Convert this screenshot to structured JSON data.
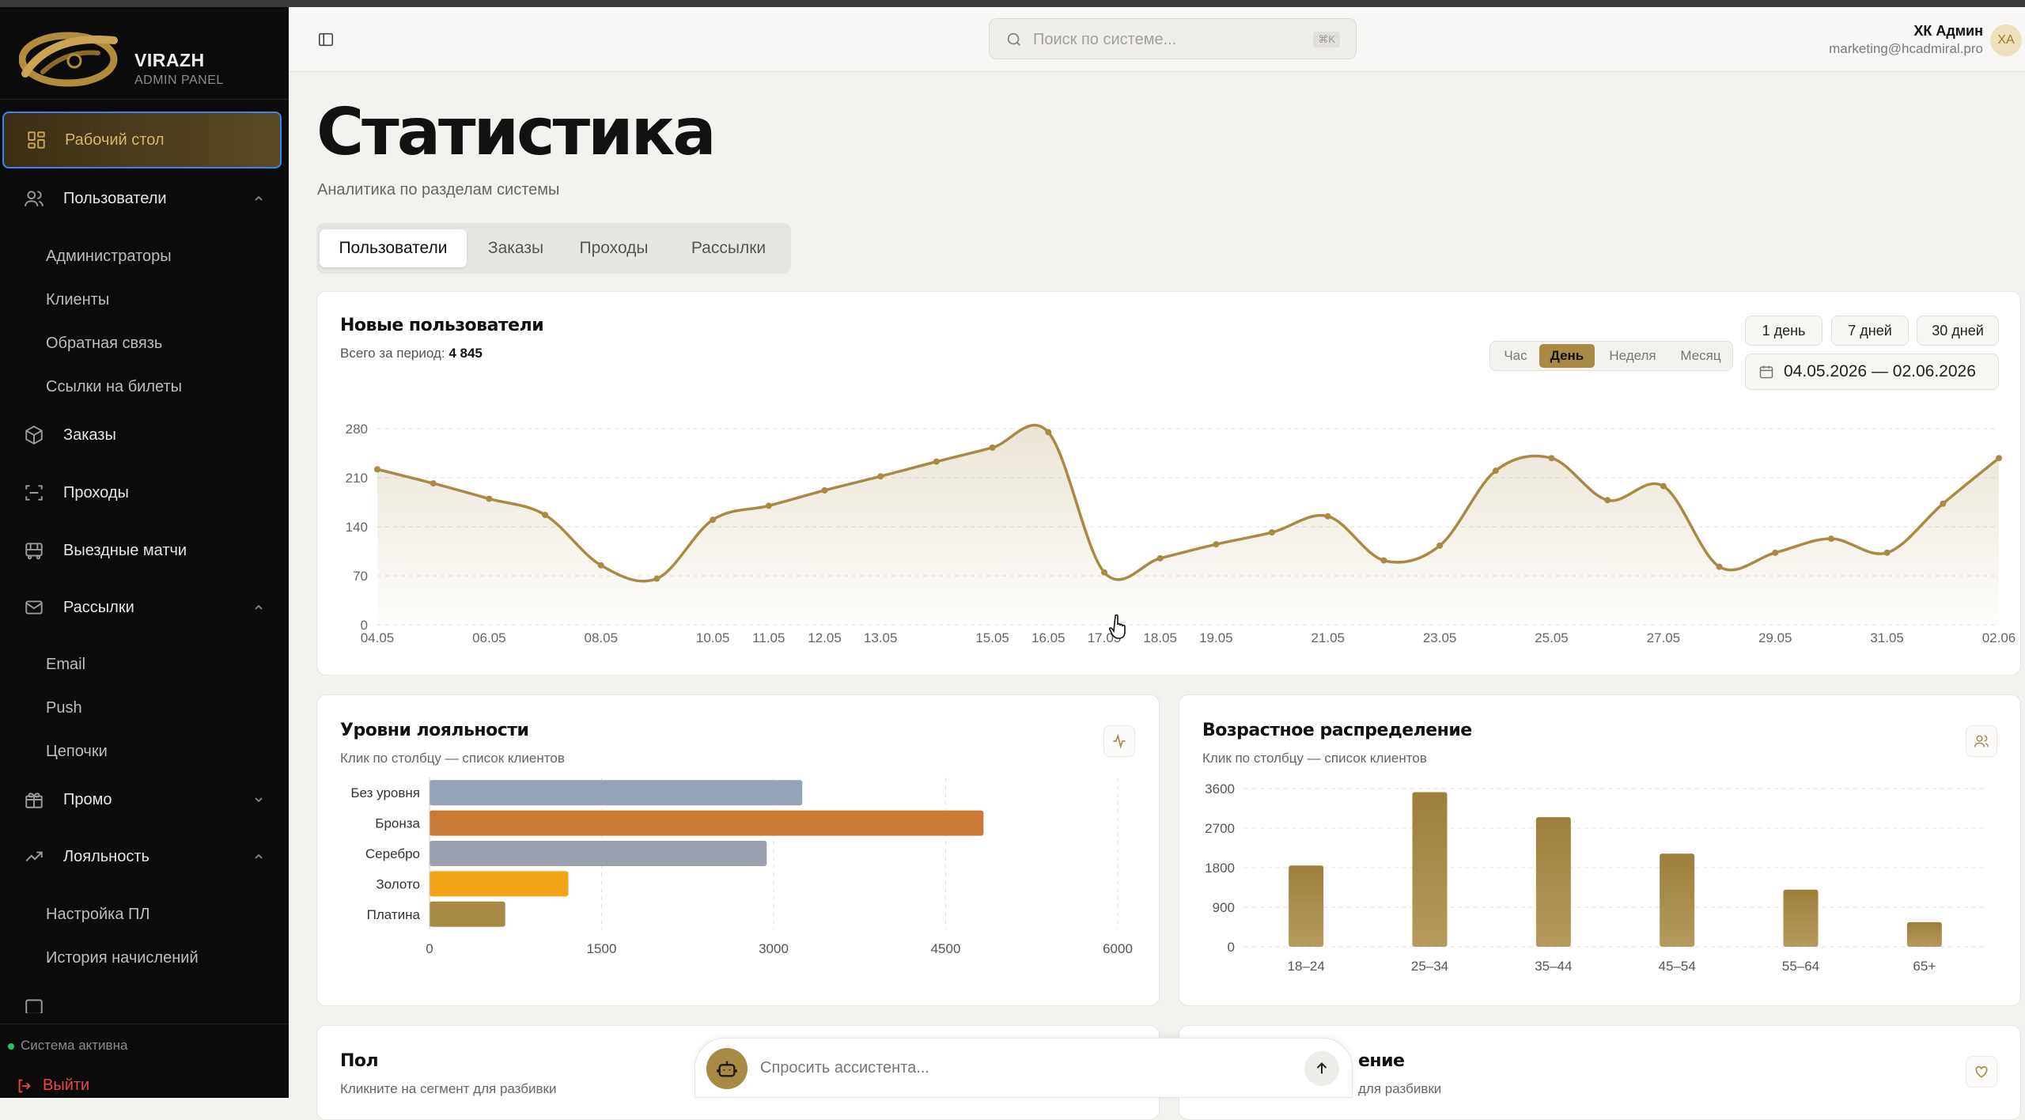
{
  "brand": {
    "name": "VIRAZH",
    "subtitle": "ADMIN PANEL"
  },
  "sidebar": {
    "active": "Рабочий стол",
    "items": [
      {
        "label": "Пользователи",
        "icon": "users-icon",
        "sub": [
          "Администраторы",
          "Клиенты",
          "Обратная связь",
          "Ссылки на билеты"
        ]
      },
      {
        "label": "Заказы",
        "icon": "box-icon"
      },
      {
        "label": "Проходы",
        "icon": "scan-icon"
      },
      {
        "label": "Выездные матчи",
        "icon": "bus-icon"
      },
      {
        "label": "Рассылки",
        "icon": "mail-icon",
        "sub": [
          "Email",
          "Push",
          "Цепочки"
        ]
      },
      {
        "label": "Промо",
        "icon": "gift-icon"
      },
      {
        "label": "Лояльность",
        "icon": "trend-up-icon",
        "sub": [
          "Настройка ПЛ",
          "История начислений"
        ]
      }
    ],
    "status": "Система активна",
    "logout": "Выйти"
  },
  "header": {
    "search_placeholder": "Поиск по системе...",
    "search_shortcut": "⌘K",
    "user_name": "ХК Админ",
    "user_email": "marketing@hcadmiral.pro",
    "avatar": "ХА"
  },
  "page": {
    "title": "Статистика",
    "subtitle": "Аналитика по разделам системы",
    "tabs": [
      "Пользователи",
      "Заказы",
      "Проходы",
      "Рассылки"
    ],
    "active_tab": "Пользователи"
  },
  "new_users": {
    "title": "Новые пользователи",
    "total_label": "Всего за период:",
    "total_value": "4 845",
    "granularity": [
      "Час",
      "День",
      "Неделя",
      "Месяц"
    ],
    "granularity_active": "День",
    "ranges": [
      "1 день",
      "7 дней",
      "30 дней"
    ],
    "date_range": "04.05.2026 — 02.06.2026"
  },
  "loyalty": {
    "title": "Уровни лояльности",
    "subtitle": "Клик по столбцу — список клиентов"
  },
  "age": {
    "title": "Возрастное распределение",
    "subtitle": "Клик по столбцу — список клиентов"
  },
  "gender": {
    "title": "Пол",
    "subtitle": "Кликните на сегмент для разбивки"
  },
  "partial_card": {
    "title_fragment": "ение",
    "subtitle_fragment": "для разбивки"
  },
  "assistant": {
    "placeholder": "Спросить ассистента..."
  },
  "colors": {
    "accent": "#a88a45",
    "bronze": "#c97a35",
    "gold": "#f0a416",
    "silver": "#9aa0ae",
    "none": "#94a3b8"
  },
  "chart_data": [
    {
      "type": "area",
      "title": "Новые пользователи",
      "x": [
        "04.05",
        "05.05",
        "06.05",
        "07.05",
        "08.05",
        "09.05",
        "10.05",
        "11.05",
        "12.05",
        "13.05",
        "14.05",
        "15.05",
        "16.05",
        "17.05",
        "18.05",
        "19.05",
        "20.05",
        "21.05",
        "22.05",
        "23.05",
        "24.05",
        "25.05",
        "26.05",
        "27.05",
        "28.05",
        "29.05",
        "30.05",
        "31.05",
        "01.06",
        "02.06"
      ],
      "x_tick_labels": [
        "04.05",
        "06.05",
        "08.05",
        "10.05",
        "11.05",
        "12.05",
        "13.05",
        "15.05",
        "16.05",
        "17.05",
        "18.05",
        "19.05",
        "21.05",
        "23.05",
        "25.05",
        "27.05",
        "29.05",
        "31.05",
        "02.06"
      ],
      "values": [
        222,
        202,
        180,
        157,
        85,
        66,
        150,
        170,
        192,
        212,
        233,
        253,
        275,
        75,
        95,
        115,
        132,
        155,
        92,
        113,
        220,
        238,
        178,
        198,
        83,
        103,
        123,
        103,
        173,
        238
      ],
      "ylim": [
        0,
        280
      ],
      "yticks": [
        0,
        70,
        140,
        210,
        280
      ],
      "grid": true
    },
    {
      "type": "bar",
      "orientation": "horizontal",
      "title": "Уровни лояльности",
      "categories": [
        "Без уровня",
        "Бронза",
        "Серебро",
        "Золото",
        "Платина"
      ],
      "values": [
        3250,
        4830,
        2940,
        1210,
        660
      ],
      "xlim": [
        0,
        6000
      ],
      "xticks": [
        0,
        1500,
        3000,
        4500,
        6000
      ],
      "grid": true
    },
    {
      "type": "bar",
      "title": "Возрастное распределение",
      "categories": [
        "18–24",
        "25–34",
        "35–44",
        "45–54",
        "55–64",
        "65+"
      ],
      "values": [
        1850,
        3520,
        2950,
        2120,
        1300,
        560
      ],
      "ylim": [
        0,
        3600
      ],
      "yticks": [
        0,
        900,
        1800,
        2700,
        3600
      ],
      "grid": true
    }
  ]
}
